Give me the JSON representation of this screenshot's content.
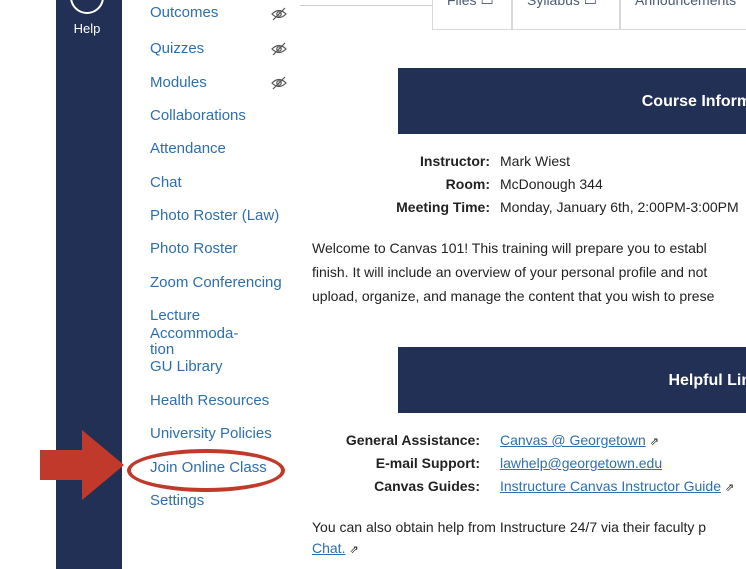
{
  "global_nav": {
    "help_label": "Help"
  },
  "course_nav": {
    "items": [
      {
        "label": "Outcomes",
        "hidden": true
      },
      {
        "label": "Quizzes",
        "hidden": true
      },
      {
        "label": "Modules",
        "hidden": true
      },
      {
        "label": "Collaborations",
        "hidden": false
      },
      {
        "label": "Attendance",
        "hidden": false
      },
      {
        "label": "Chat",
        "hidden": false
      },
      {
        "label": "Photo Roster (Law)",
        "hidden": false
      },
      {
        "label": "Photo Roster",
        "hidden": false
      },
      {
        "label": "Zoom Conferencing",
        "hidden": false
      },
      {
        "label_line1": "Lecture Accommoda-",
        "label_line2": "tion",
        "hidden": false
      },
      {
        "label": "GU Library",
        "hidden": false
      },
      {
        "label": "Health Resources",
        "hidden": false
      },
      {
        "label": "University Policies",
        "hidden": false
      },
      {
        "label": "Join Online Class",
        "hidden": false
      },
      {
        "label": "Settings",
        "hidden": false
      }
    ]
  },
  "annotation": {
    "arrow_color": "#c0392b",
    "ring_color": "#c0392b"
  },
  "main": {
    "tabs": [
      {
        "label": "Files ▭"
      },
      {
        "label": "Syllabus ▭"
      },
      {
        "label": "Announcements"
      }
    ],
    "course_info": {
      "banner": "Course Informa",
      "instructor_label": "Instructor:",
      "instructor_value": "Mark Wiest",
      "room_label": "Room:",
      "room_value": "McDonough 344",
      "meeting_label": "Meeting Time:",
      "meeting_value": "Monday, January 6th, 2:00PM-3:00PM"
    },
    "welcome_lines": [
      "Welcome to Canvas 101! This training will prepare you to establ",
      "finish. It will include an overview of your personal profile and not",
      "upload, organize, and manage the content that you wish to prese"
    ],
    "helpful_links": {
      "banner": "Helpful Link",
      "general_label": "General Assistance:",
      "general_link": "Canvas @ Georgetown",
      "email_label": "E-mail Support:",
      "email_link": "lawhelp@georgetown.edu",
      "guides_label": "Canvas Guides:",
      "guides_link": "Instructure Canvas Instructor Guide"
    },
    "footer_line": "You can also obtain help from Instructure 24/7 via their faculty p",
    "footer_link": "Chat."
  },
  "colors": {
    "nav_bg": "#233055",
    "link": "#2d6fae",
    "banner": "#233055"
  }
}
